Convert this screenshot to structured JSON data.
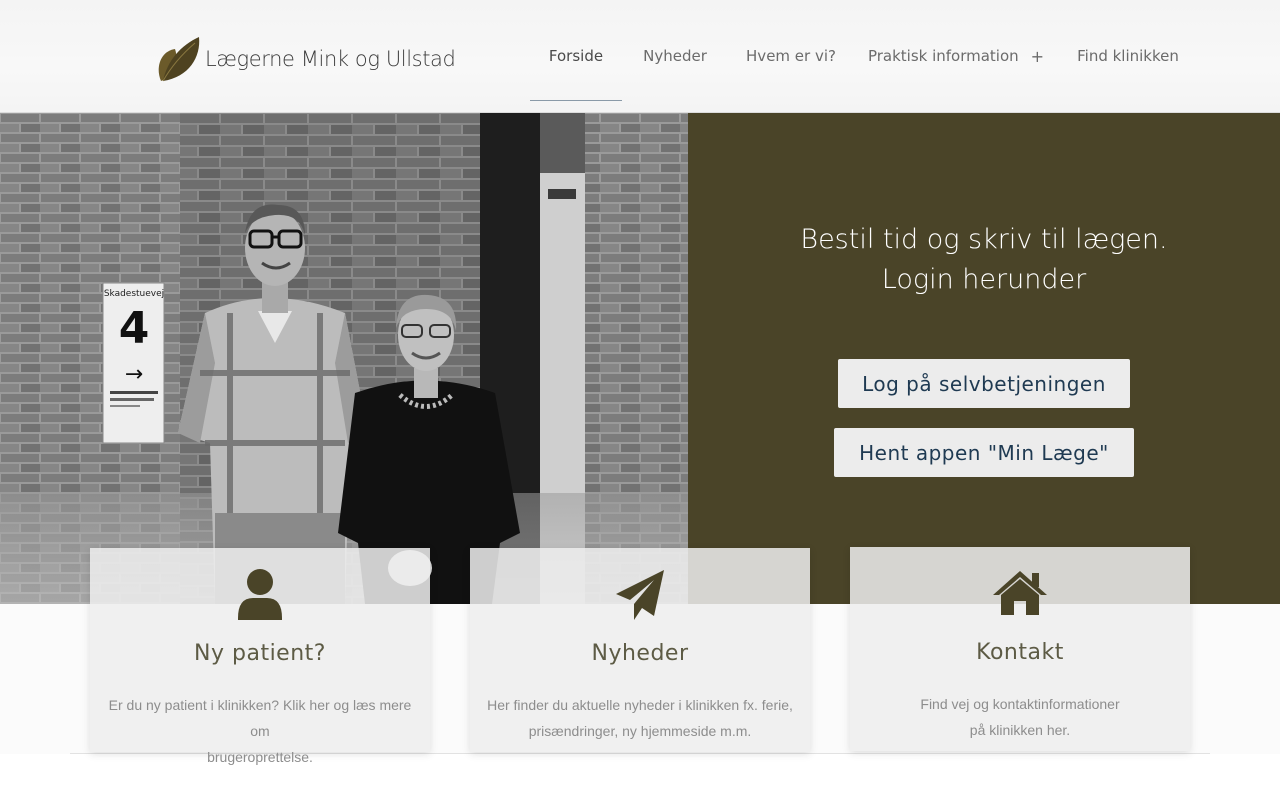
{
  "header": {
    "logo_text": "Lægerne Mink og Ullstad",
    "nav": [
      {
        "label": "Forside",
        "active": true
      },
      {
        "label": "Nyheder"
      },
      {
        "label": "Hvem er vi?"
      },
      {
        "label": "Praktisk information",
        "suffix": "+"
      },
      {
        "label": "Find klinikken"
      }
    ]
  },
  "hero": {
    "line1": "Bestil tid og skriv til lægen.",
    "line2": "Login herunder",
    "login_button": "Log på selvbetjeningen",
    "app_button": "Hent appen \"Min Læge\"",
    "photo_sign": {
      "street": "Skadestuevej",
      "number": "4",
      "arrow": "→"
    }
  },
  "cards": [
    {
      "icon": "user-icon",
      "title": "Ny patient?",
      "desc_line1": "Er du ny patient i klinikken? Klik her og læs mere om",
      "desc_line2": "brugeroprettelse."
    },
    {
      "icon": "paper-plane-icon",
      "title": "Nyheder",
      "desc_line1": "Her finder du aktuelle nyheder i klinikken fx. ferie,",
      "desc_line2": "prisændringer, ny hjemmeside m.m."
    },
    {
      "icon": "home-icon",
      "title": "Kontakt",
      "desc_line1": "Find vej og kontaktinformationer",
      "desc_line2": "på klinikken her."
    }
  ],
  "colors": {
    "panel": "#4a4428",
    "button_bg": "#ececec",
    "button_text": "#1f3a52",
    "icon": "#4a4428",
    "logo_leaf": "#5a4a20"
  }
}
